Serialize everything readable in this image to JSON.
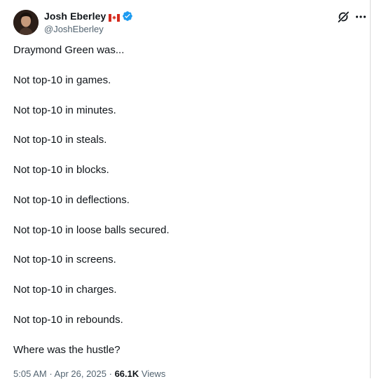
{
  "author": {
    "display_name": "Josh Eberley",
    "handle": "@JoshEberley",
    "flag_icon": "canada-flag-icon",
    "verified_icon": "verified-badge-icon",
    "verified_color": "#1d9bf0"
  },
  "header_actions": {
    "grok_icon": "grok-icon",
    "more_icon": "more-options-icon"
  },
  "tweet": {
    "lines": [
      "Draymond Green was...",
      "Not top-10 in games.",
      "Not top-10 in minutes.",
      "Not top-10 in steals.",
      "Not top-10 in blocks.",
      "Not top-10 in deflections.",
      "Not top-10 in loose balls secured.",
      "Not top-10 in screens.",
      "Not top-10 in charges.",
      "Not top-10 in rebounds.",
      "Where was the hustle?"
    ]
  },
  "meta": {
    "time": "5:05 AM",
    "separator": " · ",
    "date": "Apr 26, 2025",
    "views_count": "66.1K",
    "views_label": " Views"
  },
  "colors": {
    "text": "#0f1419",
    "secondary": "#536471",
    "accent": "#1d9bf0"
  }
}
